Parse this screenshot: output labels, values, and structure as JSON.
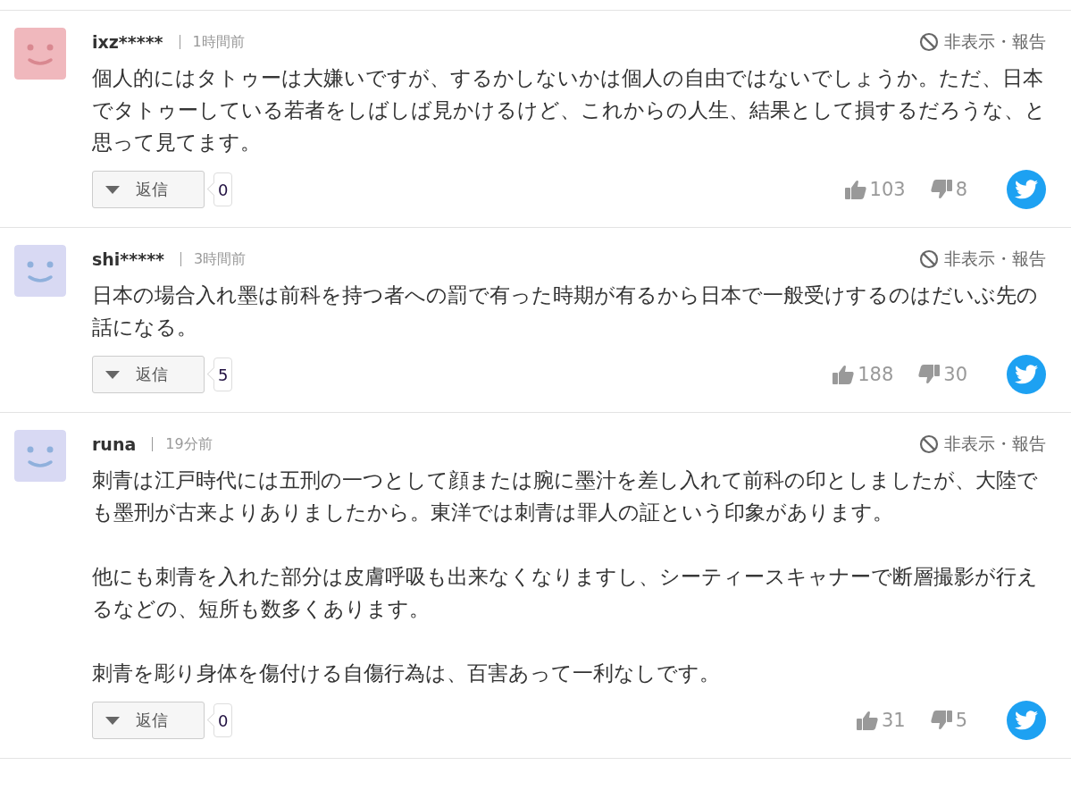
{
  "comments": [
    {
      "user": "ixz*****",
      "time": "1時間前",
      "color": "#f0b8bd",
      "hide_report": "非表示・報告",
      "paragraphs": [
        "個人的にはタトゥーは大嫌いですが、するかしないかは個人の自由ではないでしょうか。ただ、日本でタトゥーしている若者をしばしば見かけるけど、これからの人生、結果として損するだろうな、と思って見てます。"
      ],
      "reply_label": "返信",
      "reply_count": "0",
      "likes": "103",
      "dislikes": "8"
    },
    {
      "user": "shi*****",
      "time": "3時間前",
      "color": "#d8d9f3",
      "hide_report": "非表示・報告",
      "paragraphs": [
        "日本の場合入れ墨は前科を持つ者への罰で有った時期が有るから日本で一般受けするのはだいぶ先の話になる。"
      ],
      "reply_label": "返信",
      "reply_count": "5",
      "likes": "188",
      "dislikes": "30"
    },
    {
      "user": "runa",
      "time": "19分前",
      "color": "#d8d9f3",
      "hide_report": "非表示・報告",
      "paragraphs": [
        "刺青は江戸時代には五刑の一つとして顔または腕に墨汁を差し入れて前科の印としましたが、大陸でも墨刑が古来よりありましたから。東洋では刺青は罪人の証という印象があります。",
        "他にも刺青を入れた部分は皮膚呼吸も出来なくなりますし、シーティースキャナーで断層撮影が行えるなどの、短所も数多くあります。",
        "刺青を彫り身体を傷付ける自傷行為は、百害あって一利なしです。"
      ],
      "reply_label": "返信",
      "reply_count": "0",
      "likes": "31",
      "dislikes": "5"
    }
  ]
}
